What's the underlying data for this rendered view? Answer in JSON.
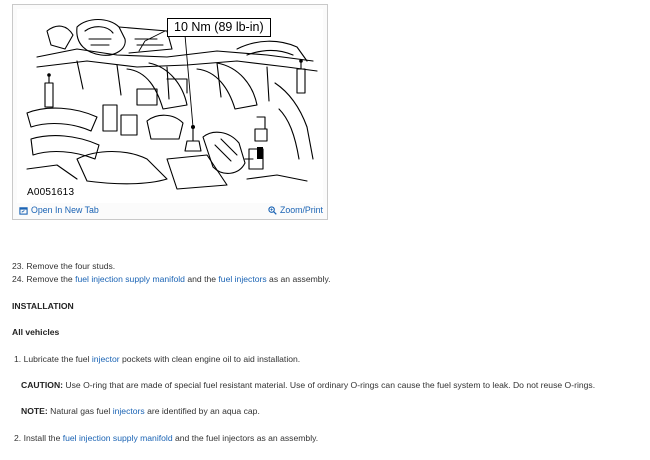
{
  "figure": {
    "torque_label": "10 Nm (89 lb-in)",
    "figure_id": "A0051613",
    "open_new_tab_label": "Open In New Tab",
    "zoom_print_label": "Zoom/Print",
    "icons": {
      "open_tab": "open-new-tab-icon",
      "zoom": "magnifier-icon"
    }
  },
  "steps_removal": [
    {
      "number": "23.",
      "segments": [
        {
          "text": "Remove the four studs.",
          "link": false
        }
      ]
    },
    {
      "number": "24.",
      "segments": [
        {
          "text": "Remove the ",
          "link": false
        },
        {
          "text": "fuel injection supply manifold",
          "link": true
        },
        {
          "text": " and the ",
          "link": false
        },
        {
          "text": "fuel injectors",
          "link": true
        },
        {
          "text": " as an assembly.",
          "link": false
        }
      ]
    }
  ],
  "section_heading": "INSTALLATION",
  "subheading": "All vehicles",
  "install_step1": {
    "number": "1.",
    "segments": [
      {
        "text": "Lubricate the fuel ",
        "link": false
      },
      {
        "text": "injector",
        "link": true
      },
      {
        "text": " pockets with clean engine oil to aid installation.",
        "link": false
      }
    ]
  },
  "caution": {
    "label": "CAUTION:",
    "text": " Use O-ring that are made of special fuel resistant material. Use of ordinary O-rings can cause the fuel system to leak. Do not reuse O-rings."
  },
  "note": {
    "label": "NOTE:",
    "segments": [
      {
        "text": " Natural gas fuel ",
        "link": false
      },
      {
        "text": "injectors",
        "link": true
      },
      {
        "text": " are identified by an aqua cap.",
        "link": false
      }
    ]
  },
  "install_step2": {
    "number": "2.",
    "segments": [
      {
        "text": "Install the ",
        "link": false
      },
      {
        "text": "fuel injection supply manifold",
        "link": true
      },
      {
        "text": " and the fuel injectors as an assembly.",
        "link": false
      }
    ]
  },
  "colors": {
    "link": "#1a63b4",
    "text": "#333333"
  }
}
